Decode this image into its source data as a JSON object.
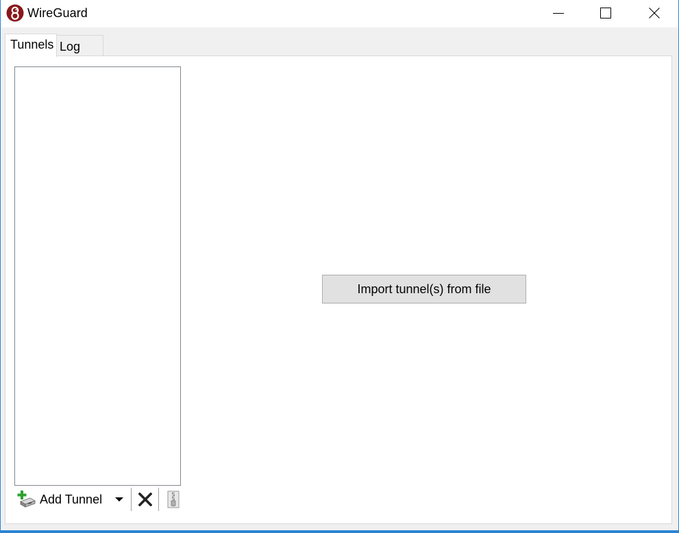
{
  "window": {
    "title": "WireGuard",
    "accent_color": "#2b84d4",
    "logo_color": "#88171a"
  },
  "window_controls": {
    "minimize_icon": "minimize-icon",
    "maximize_icon": "maximize-icon",
    "close_icon": "close-icon"
  },
  "tabs": [
    {
      "label": "Tunnels",
      "selected": true
    },
    {
      "label": "Log",
      "selected": false
    }
  ],
  "tunnel_list": {
    "items": []
  },
  "toolbar": {
    "add_tunnel_label": "Add Tunnel",
    "add_tunnel_icon": "add-tunnel-icon",
    "dropdown_icon": "chevron-down-icon",
    "remove_icon": "delete-icon",
    "export_icon": "zip-archive-icon"
  },
  "main": {
    "import_button_label": "Import tunnel(s) from file"
  }
}
